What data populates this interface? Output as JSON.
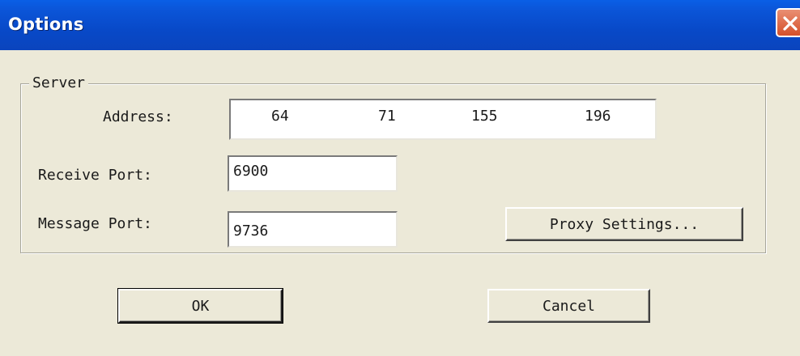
{
  "window": {
    "title": "Options"
  },
  "server_group": {
    "label": "Server",
    "address": {
      "label": "Address:",
      "octets": [
        "64",
        "71",
        "155",
        "196"
      ]
    },
    "receive_port": {
      "label": "Receive Port:",
      "value": "6900"
    },
    "message_port": {
      "label": "Message Port:",
      "value": "9736"
    },
    "proxy_button_label": "Proxy Settings..."
  },
  "buttons": {
    "ok_label": "OK",
    "cancel_label": "Cancel"
  },
  "icons": {
    "close": "close-icon"
  },
  "colors": {
    "titlebar": "#0a52d6",
    "close_button": "#d9572f",
    "dialog_background": "#ece9d8"
  }
}
